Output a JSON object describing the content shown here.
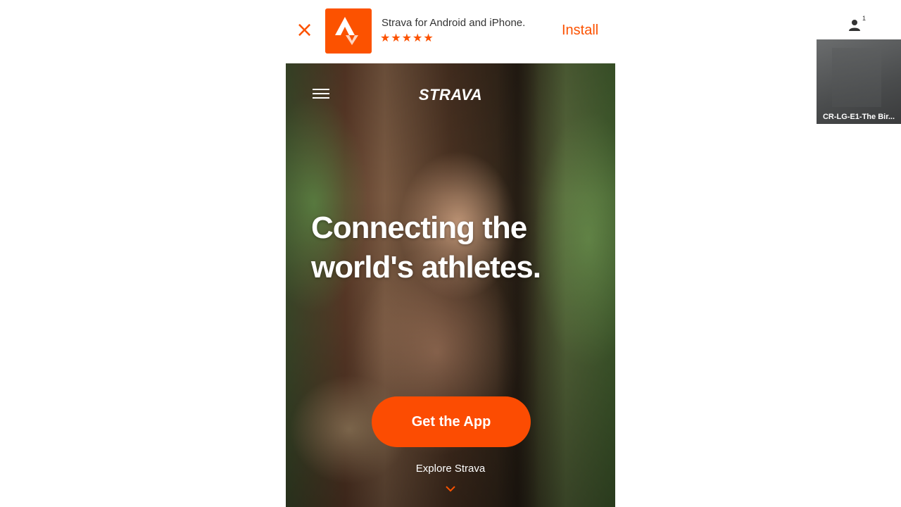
{
  "app_banner": {
    "close_glyph": "×",
    "title": "Strava for Android and iPhone.",
    "stars": "★★★★★",
    "rating_stars": 4.5,
    "install_label": "Install",
    "icon": "strava-logo-icon"
  },
  "site": {
    "brand": "STRAVA",
    "menu_icon": "hamburger-menu-icon",
    "headline": "Connecting the world's athletes.",
    "cta_label": "Get the App",
    "explore_label": "Explore Strava",
    "explore_icon": "chevron-down-icon"
  },
  "meeting": {
    "participants_count": "1",
    "participants_icon": "person-icon",
    "tile_label": "CR-LG-E1-The Bir..."
  },
  "colors": {
    "accent": "#fc5200",
    "cta": "#fc4c02"
  }
}
